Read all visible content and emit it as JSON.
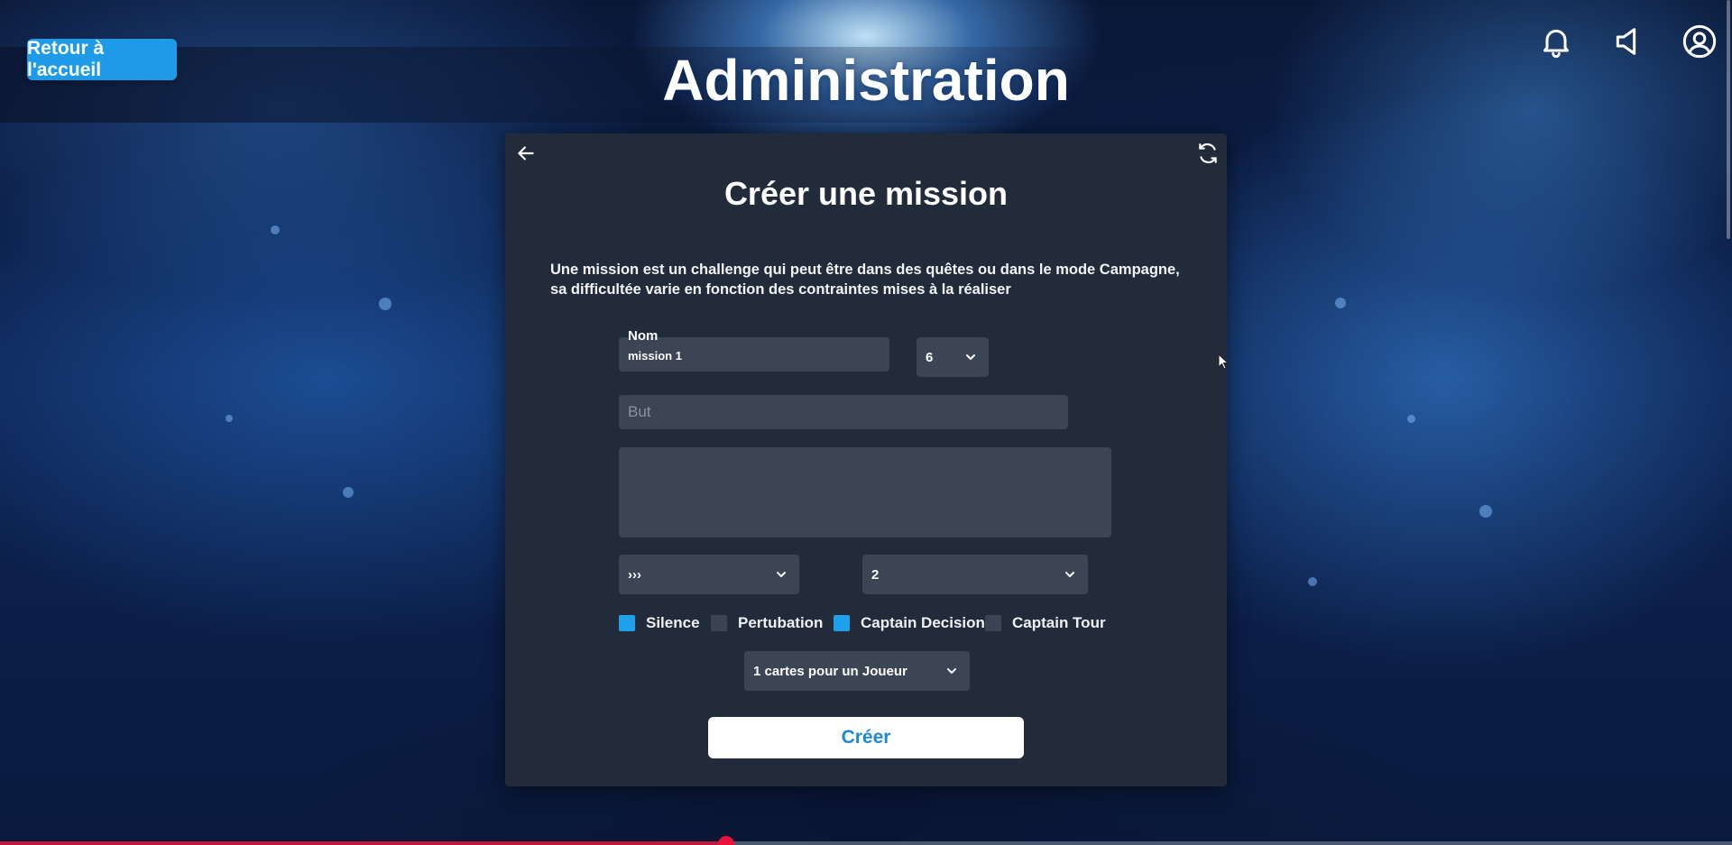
{
  "header": {
    "back_home_label": "Retour à l'accueil",
    "title": "Administration",
    "icons": [
      "bell-icon",
      "speaker-icon",
      "account-icon"
    ]
  },
  "form": {
    "title": "Créer une mission",
    "description": "Une mission est un challenge qui peut être dans des quêtes ou dans le mode Campagne, sa difficultée varie en fonction des contraintes mises à la réaliser",
    "name_label": "Nom",
    "name_value": "mission 1",
    "level_value": "6",
    "goal_placeholder": "But",
    "direction_value": "›››",
    "count_value": "2",
    "checkboxes": [
      {
        "label": "Silence",
        "checked": true
      },
      {
        "label": "Pertubation",
        "checked": false
      },
      {
        "label": "Captain Decision",
        "checked": true
      },
      {
        "label": "Captain Tour",
        "checked": false
      }
    ],
    "cards_value": "1 cartes pour un Joueur",
    "create_label": "Créer"
  },
  "colors": {
    "accent": "#1e9be8",
    "panel": "#222b39",
    "field": "#3b4553",
    "checked": "#1ea0ea"
  }
}
